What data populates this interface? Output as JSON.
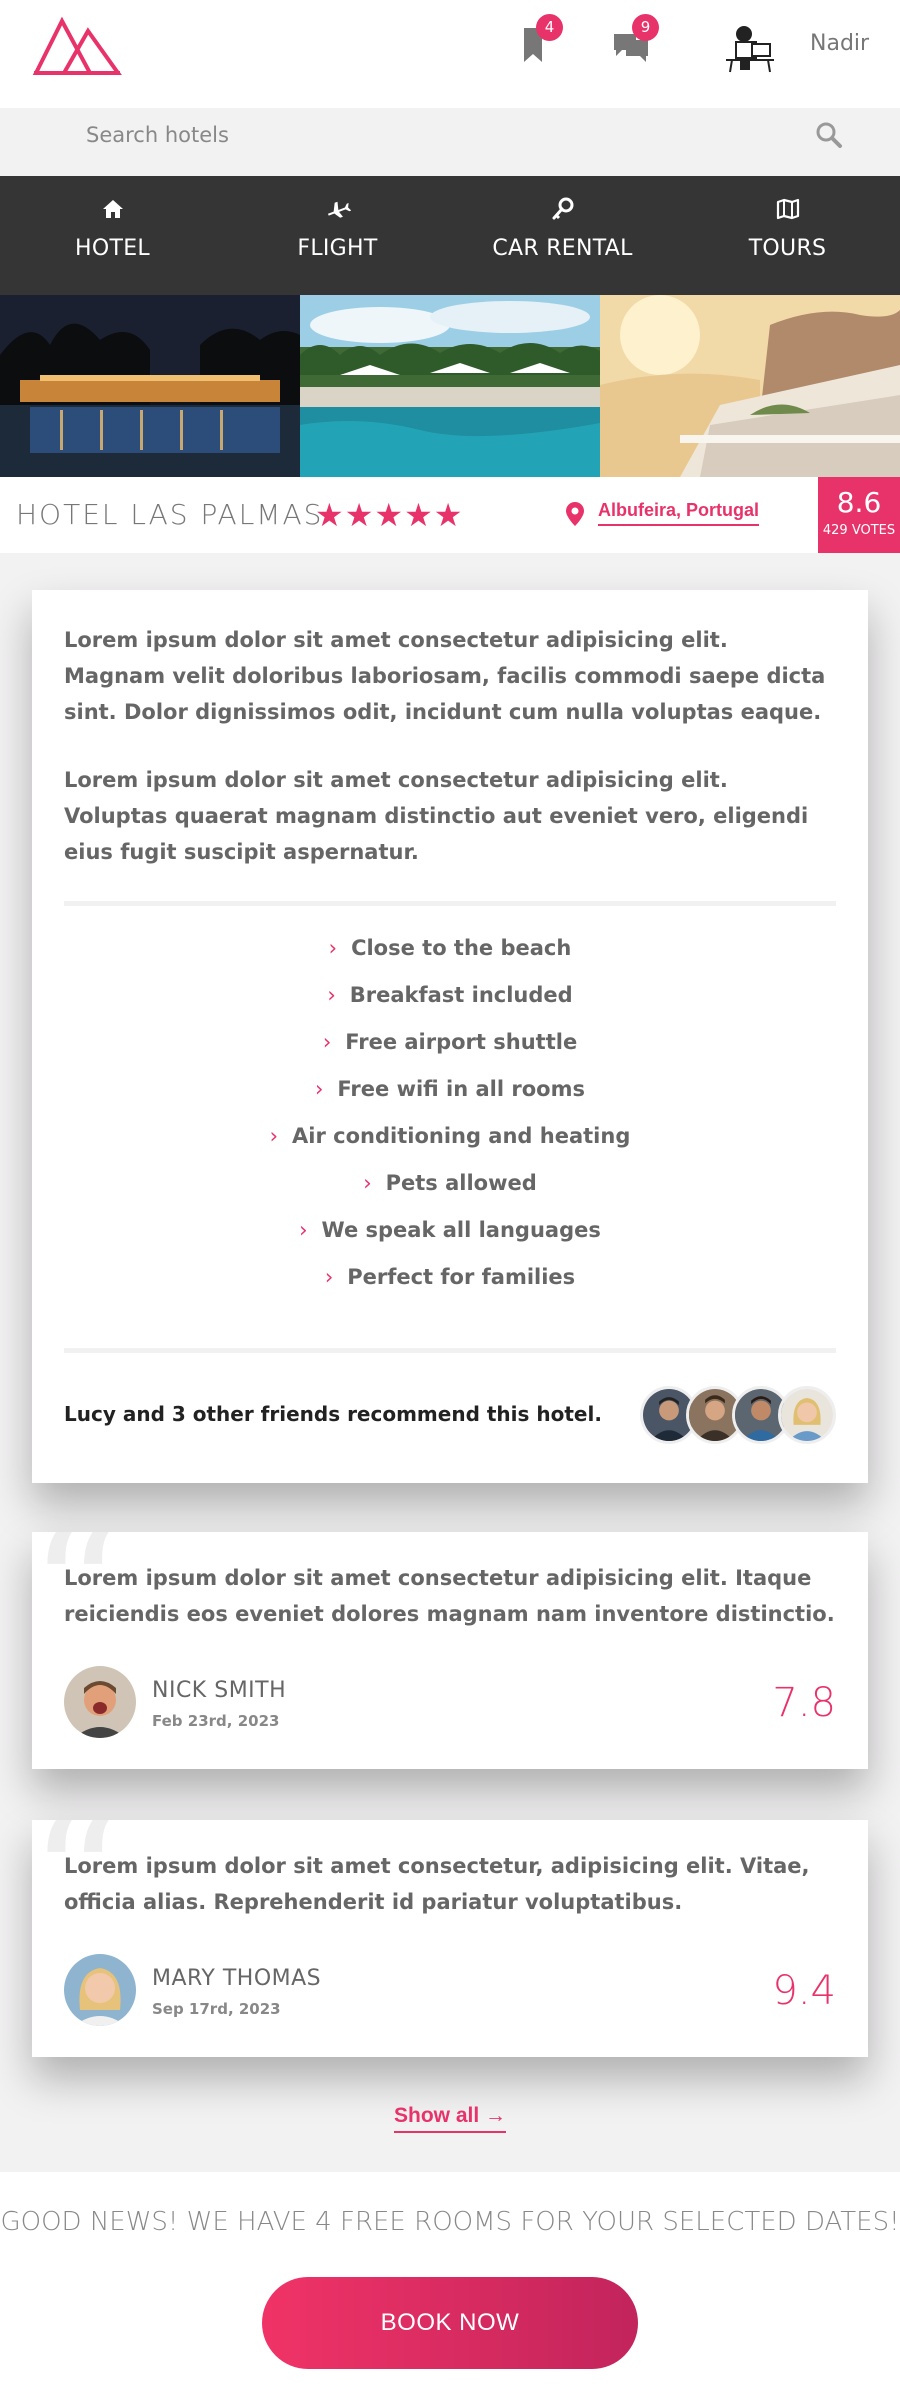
{
  "header": {
    "bookmarks_count": "4",
    "messages_count": "9",
    "user_name": "Nadir"
  },
  "search": {
    "placeholder": "Search hotels"
  },
  "nav": {
    "items": [
      {
        "label": "HOTEL",
        "icon": "home-icon"
      },
      {
        "label": "FLIGHT",
        "icon": "plane-icon"
      },
      {
        "label": "CAR RENTAL",
        "icon": "key-icon"
      },
      {
        "label": "TOURS",
        "icon": "map-icon"
      }
    ]
  },
  "hotel": {
    "name": "HOTEL LAS PALMAS",
    "stars": "★★★★★",
    "location": "Albufeira, Portugal",
    "score": "8.6",
    "votes": "429 VOTES"
  },
  "description": {
    "paragraph1": "Lorem ipsum dolor sit amet consectetur adipisicing elit. Magnam velit doloribus laboriosam, facilis commodi saepe dicta sint. Dolor dignissimos odit, incidunt cum nulla voluptas eaque.",
    "paragraph2": "Lorem ipsum dolor sit amet consectetur adipisicing elit. Voluptas quaerat magnam distinctio aut eveniet vero, eligendi eius fugit suscipit aspernatur."
  },
  "features": [
    "Close to the beach",
    "Breakfast included",
    "Free airport shuttle",
    "Free wifi in all rooms",
    "Air conditioning and heating",
    "Pets allowed",
    "We speak all languages",
    "Perfect for families"
  ],
  "recommend": {
    "text": "Lucy and 3 other friends recommend this hotel."
  },
  "reviews": [
    {
      "text": "Lorem ipsum dolor sit amet consectetur adipisicing elit. Itaque reiciendis eos eveniet dolores magnam nam inventore distinctio.",
      "name": "NICK SMITH",
      "date": "Feb 23rd, 2023",
      "score": "7.8"
    },
    {
      "text": "Lorem ipsum dolor sit amet consectetur, adipisicing elit. Vitae, officia alias. Reprehenderit id pariatur voluptatibus.",
      "name": "MARY THOMAS",
      "date": "Sep 17rd, 2023",
      "score": "9.4"
    }
  ],
  "show_all": "Show all →",
  "footer": {
    "good_news": "GOOD NEWS! WE HAVE 4 FREE ROOMS FOR YOUR SELECTED DATES!",
    "book_label": "BOOK NOW"
  },
  "colors": {
    "accent": "#e8336a",
    "nav_bg": "#353535",
    "page_bg": "#f3f2f3"
  }
}
